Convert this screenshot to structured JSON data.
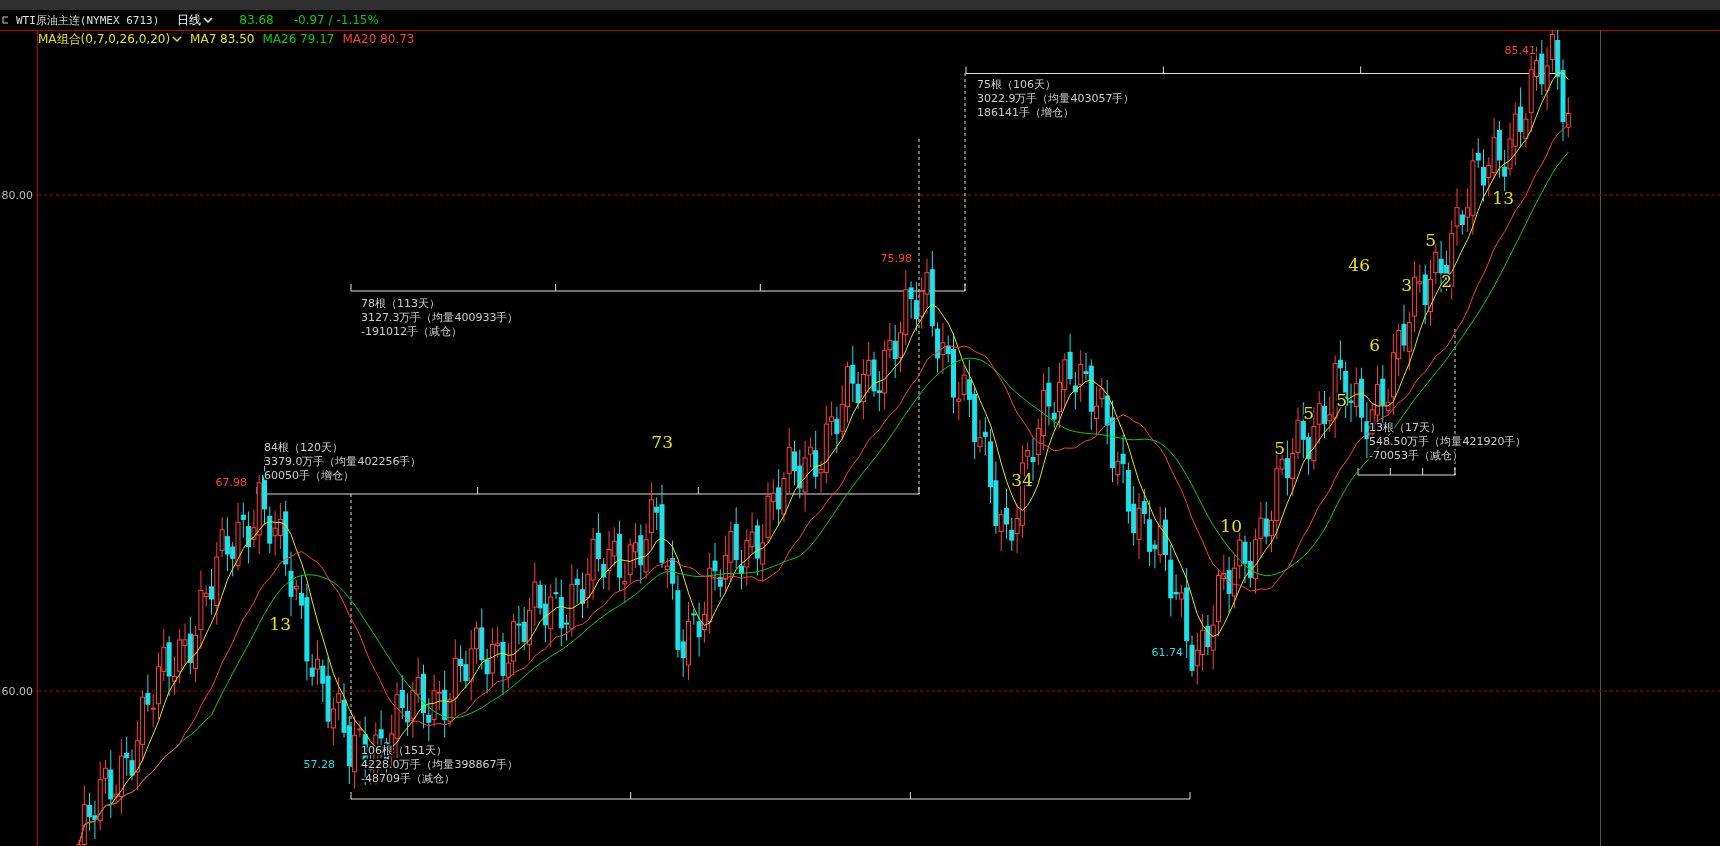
{
  "header": {
    "symbol": "WTI原油主连(NYMEX 6713)",
    "period": "日线",
    "last": "83.68",
    "change": "-0.97 / -1.15%"
  },
  "indicators": {
    "name": "MA组合(0,7,0,26,0,20)",
    "values": [
      {
        "label": "MA7 83.50",
        "color": "#e6e600"
      },
      {
        "label": "MA26 79.17",
        "color": "#00d000"
      },
      {
        "label": "MA20 80.73",
        "color": "#ff3c3c"
      }
    ]
  },
  "axis_labels": [
    "80.00",
    "60.00"
  ],
  "price_marks": [
    {
      "text": "67.98",
      "kind": "high"
    },
    {
      "text": "57.28",
      "kind": "low"
    },
    {
      "text": "75.98",
      "kind": "high"
    },
    {
      "text": "61.74",
      "kind": "low"
    },
    {
      "text": "85.41",
      "kind": "high"
    }
  ],
  "spans": [
    {
      "lines": [
        "84根（120天）",
        "3379.0万手（均量402256手）",
        "60050手（增仓）"
      ]
    },
    {
      "lines": [
        "78根（113天）",
        "3127.3万手（均量400933手）",
        "-191012手（减仓）"
      ]
    },
    {
      "lines": [
        "75根（106天）",
        "3022.9万手（均量403057手）",
        "186141手（增仓）"
      ]
    },
    {
      "lines": [
        "13根（17天）",
        "548.50万手（均量421920手）",
        "-70053手（减仓）"
      ]
    },
    {
      "lines": [
        "106根（151天）",
        "4228.0万手（均量398867手）",
        "-48709手（减仓）"
      ]
    }
  ],
  "wave_counts": [
    "13",
    "73",
    "34",
    "10",
    "5",
    "5",
    "5",
    "6",
    "46",
    "3",
    "2",
    "5",
    "13"
  ]
}
